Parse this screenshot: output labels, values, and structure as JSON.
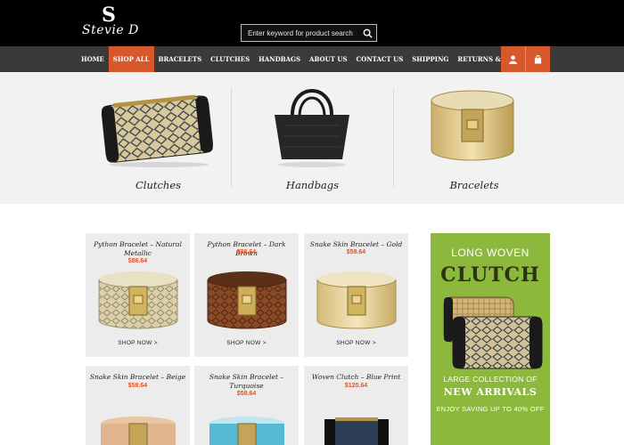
{
  "brand": {
    "logo_text": "Stevie D",
    "logo_mark": "S"
  },
  "search": {
    "placeholder": "Enter keyword for product search"
  },
  "nav": {
    "items": [
      "HOME",
      "SHOP ALL",
      "BRACELETS",
      "CLUTCHES",
      "HANDBAGS",
      "ABOUT US",
      "CONTACT US",
      "SHIPPING",
      "RETURNS & EXCHANGE"
    ],
    "active": "SHOP ALL",
    "icons": [
      "user-icon",
      "shopping-bag-icon"
    ]
  },
  "categories": [
    {
      "label": "Clutches"
    },
    {
      "label": "Handbags"
    },
    {
      "label": "Bracelets"
    }
  ],
  "products": [
    {
      "name": "Python Bracelet – Natural Metallic",
      "price": "$86.64",
      "cta": "SHOP NOW  >"
    },
    {
      "name": "Python Bracelet – Dark Brown",
      "price": "$86.64",
      "cta": "SHOP NOW  >"
    },
    {
      "name": "Snake Skin Bracelet – Gold",
      "price": "$58.64",
      "cta": "SHOP NOW  >"
    },
    {
      "name": "Snake Skin Bracelet – Beige",
      "price": "$58.64",
      "cta": ""
    },
    {
      "name": "Snake Skin Bracelet – Turquoise",
      "price": "$58.64",
      "cta": ""
    },
    {
      "name": "Woven Clutch – Blue Print",
      "price": "$120.64",
      "cta": ""
    }
  ],
  "promo": {
    "line1": "LONG WOVEN",
    "line2": "CLUTCH",
    "line3": "LARGE COLLECTION OF",
    "line4": "NEW ARRIVALS",
    "line5": "ENJOY SAVING UP TO 40% OFF"
  },
  "colors": {
    "accent": "#d6582b",
    "header_bg": "#000000",
    "nav_bg": "#3a3a3a",
    "promo_bg": "#8cb83e"
  }
}
